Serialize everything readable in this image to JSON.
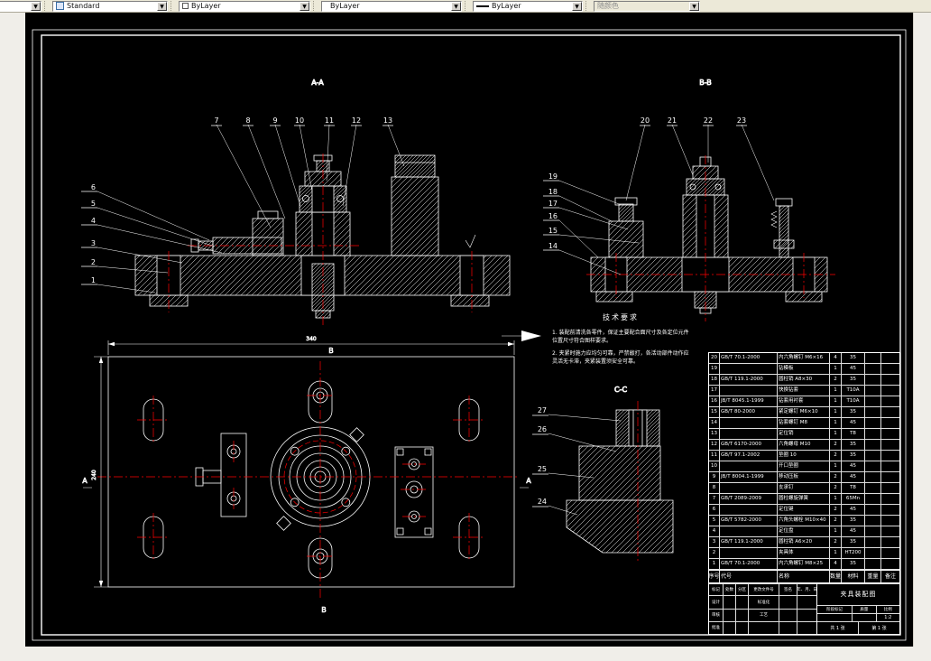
{
  "toolbar": {
    "style_label": "Standard",
    "color_label": "ByLayer",
    "linetype_label": "ByLayer",
    "lineweight_label": "ByLayer",
    "plotstyle_label": "随颜色"
  },
  "drawing": {
    "view_aa": "A-A",
    "view_bb": "B-B",
    "view_cc": "C-C",
    "section_a": "A",
    "section_b": "B",
    "dim_width": "340",
    "dim_height": "240",
    "tech": {
      "title": "技术要求",
      "lines": [
        "1. 装配前清洗各零件，保证主要配合面尺寸及各定位元件",
        "   位置尺寸符合图样要求。",
        "2. 夹紧时施力应均匀可靠，严禁敲打，各活动部件动作应",
        "   灵活无卡滞，夹紧装置须安全可靠。"
      ]
    },
    "balloons": {
      "aa_top": [
        "7",
        "8",
        "9",
        "10",
        "11",
        "12",
        "13"
      ],
      "aa_left": [
        "6",
        "5",
        "4",
        "3",
        "2",
        "1"
      ],
      "bb_top": [
        "20",
        "21",
        "22",
        "23"
      ],
      "bb_left": [
        "19",
        "18",
        "17",
        "16",
        "15",
        "14"
      ],
      "cc_left": [
        "27",
        "26",
        "25",
        "24"
      ]
    }
  },
  "bom": {
    "header": [
      "序号",
      "代号",
      "名称",
      "数量",
      "材料",
      "重量",
      "备注"
    ],
    "rows": [
      {
        "no": "20",
        "code": "GB/T 70.1-2000",
        "name": "内六角螺钉 M6×16",
        "qty": "4",
        "mat": "35",
        "weight": "",
        "remark": ""
      },
      {
        "no": "19",
        "code": "",
        "name": "钻模板",
        "qty": "1",
        "mat": "45",
        "weight": "",
        "remark": ""
      },
      {
        "no": "18",
        "code": "GB/T 119.1-2000",
        "name": "圆柱销 A8×30",
        "qty": "2",
        "mat": "35",
        "weight": "",
        "remark": ""
      },
      {
        "no": "17",
        "code": "",
        "name": "快换钻套",
        "qty": "1",
        "mat": "T10A",
        "weight": "",
        "remark": ""
      },
      {
        "no": "16",
        "code": "JB/T 8045.1-1999",
        "name": "钻套用衬套",
        "qty": "1",
        "mat": "T10A",
        "weight": "",
        "remark": ""
      },
      {
        "no": "15",
        "code": "GB/T 80-2000",
        "name": "紧定螺钉 M6×10",
        "qty": "1",
        "mat": "35",
        "weight": "",
        "remark": ""
      },
      {
        "no": "14",
        "code": "",
        "name": "钻套螺钉 M8",
        "qty": "1",
        "mat": "45",
        "weight": "",
        "remark": ""
      },
      {
        "no": "13",
        "code": "",
        "name": "定位销",
        "qty": "1",
        "mat": "T8",
        "weight": "",
        "remark": ""
      },
      {
        "no": "12",
        "code": "GB/T 6170-2000",
        "name": "六角螺母 M10",
        "qty": "2",
        "mat": "35",
        "weight": "",
        "remark": ""
      },
      {
        "no": "11",
        "code": "GB/T 97.1-2002",
        "name": "垫圈 10",
        "qty": "2",
        "mat": "35",
        "weight": "",
        "remark": ""
      },
      {
        "no": "10",
        "code": "",
        "name": "开口垫圈",
        "qty": "1",
        "mat": "45",
        "weight": "",
        "remark": ""
      },
      {
        "no": "9",
        "code": "JB/T 8004.1-1999",
        "name": "移动压板",
        "qty": "2",
        "mat": "45",
        "weight": "",
        "remark": ""
      },
      {
        "no": "8",
        "code": "",
        "name": "支承钉",
        "qty": "2",
        "mat": "T8",
        "weight": "",
        "remark": ""
      },
      {
        "no": "7",
        "code": "GB/T 2089-2009",
        "name": "圆柱螺旋弹簧",
        "qty": "1",
        "mat": "65Mn",
        "weight": "",
        "remark": ""
      },
      {
        "no": "6",
        "code": "",
        "name": "定位键",
        "qty": "2",
        "mat": "45",
        "weight": "",
        "remark": ""
      },
      {
        "no": "5",
        "code": "GB/T 5782-2000",
        "name": "六角头螺栓 M10×40",
        "qty": "2",
        "mat": "35",
        "weight": "",
        "remark": ""
      },
      {
        "no": "4",
        "code": "",
        "name": "定位盘",
        "qty": "1",
        "mat": "45",
        "weight": "",
        "remark": ""
      },
      {
        "no": "3",
        "code": "GB/T 119.1-2000",
        "name": "圆柱销 A6×20",
        "qty": "2",
        "mat": "35",
        "weight": "",
        "remark": ""
      },
      {
        "no": "2",
        "code": "",
        "name": "夹具体",
        "qty": "1",
        "mat": "HT200",
        "weight": "",
        "remark": ""
      },
      {
        "no": "1",
        "code": "GB/T 70.1-2000",
        "name": "内六角螺钉 M8×25",
        "qty": "4",
        "mat": "35",
        "weight": "",
        "remark": ""
      }
    ]
  },
  "titleblock": {
    "name": "夹具装配图",
    "rows": [
      [
        "标记",
        "处数",
        "分区",
        "更改文件号",
        "签名",
        "年、月、日"
      ],
      [
        "设计",
        "",
        "",
        "标准化",
        "",
        ""
      ],
      [
        "审核",
        "",
        "",
        "工艺",
        "",
        ""
      ],
      [
        "批准",
        "",
        "",
        "",
        "",
        ""
      ]
    ],
    "stage_label": "阶段标记",
    "weight_label": "质量",
    "scale_label": "比例",
    "scale_value": "1:2",
    "sheet_total": "共 1 张",
    "sheet_no": "第 1 张"
  }
}
